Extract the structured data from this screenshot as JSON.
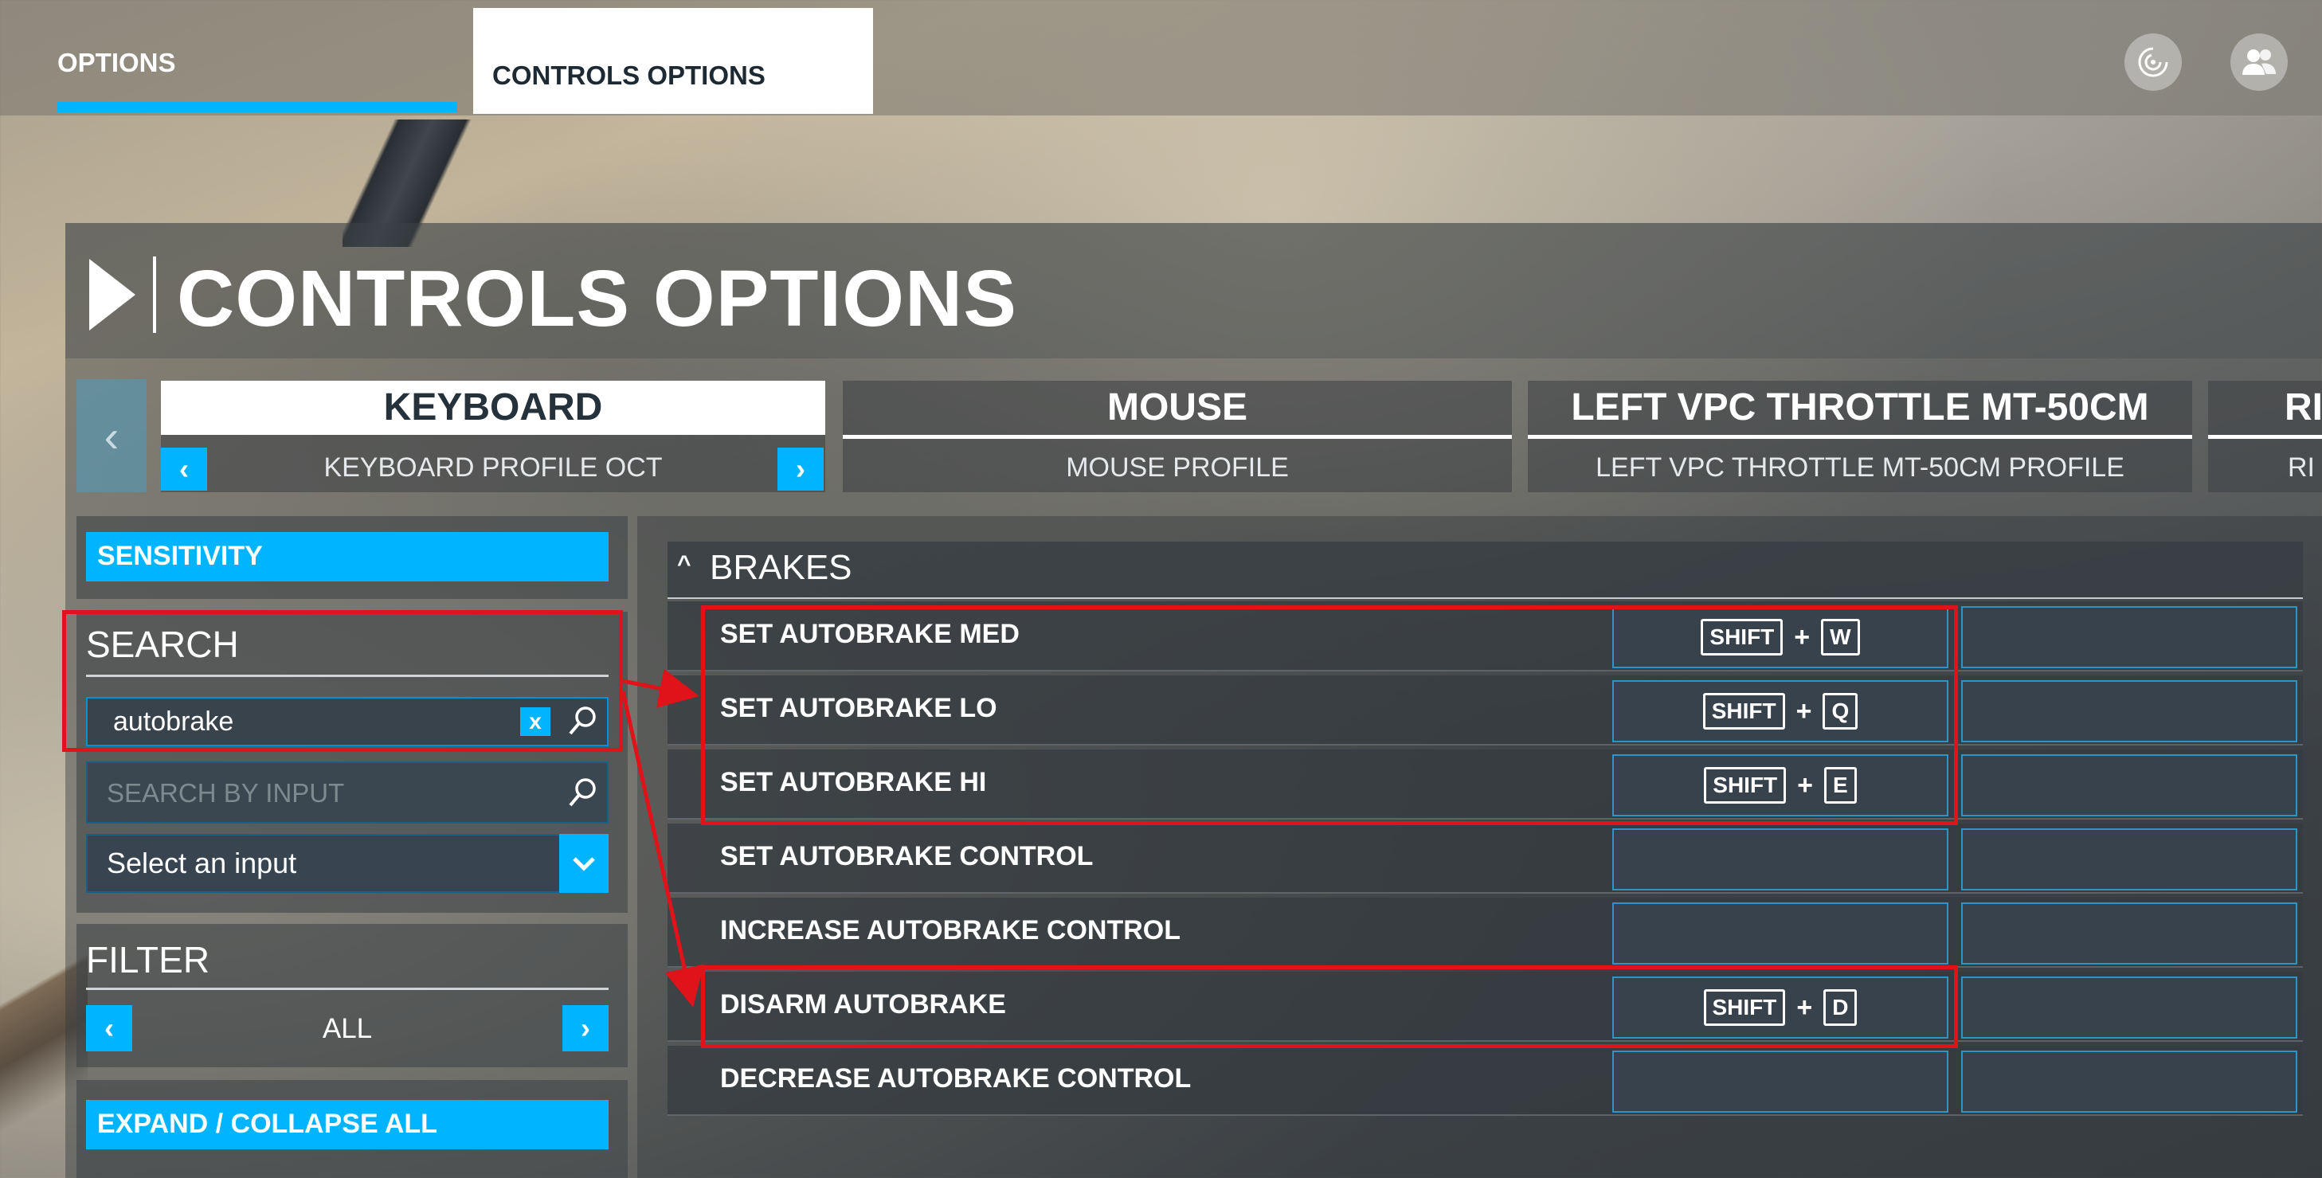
{
  "top_tabs": {
    "options": "OPTIONS",
    "controls_options": "CONTROLS OPTIONS"
  },
  "icons": {
    "sync": "sync-icon",
    "profile": "profile-icon",
    "search": "search-icon",
    "clear": "clear-icon",
    "dropdown": "chevron-down-icon"
  },
  "page_title": "CONTROLS OPTIONS",
  "devices": [
    {
      "name": "KEYBOARD",
      "profile": "KEYBOARD PROFILE OCT"
    },
    {
      "name": "MOUSE",
      "profile": "MOUSE PROFILE"
    },
    {
      "name": "LEFT VPC THROTTLE MT-50CM",
      "profile": "LEFT VPC THROTTLE MT-50CM PROFILE"
    },
    {
      "name": "RI",
      "profile": "RI"
    }
  ],
  "sidebar": {
    "sensitivity": "SENSITIVITY",
    "search_title": "SEARCH",
    "search_value": "autobrake",
    "clear_label": "x",
    "search_by_input_placeholder": "SEARCH BY INPUT",
    "select_input": "Select an input",
    "filter_title": "FILTER",
    "filter_value": "ALL",
    "expand_collapse": "EXPAND / COLLAPSE ALL"
  },
  "section": {
    "title": "BRAKES",
    "caret": "^"
  },
  "bindings": [
    {
      "label": "SET AUTOBRAKE MED",
      "modifier": "SHIFT",
      "plus": "+",
      "key": "W"
    },
    {
      "label": "SET AUTOBRAKE LO",
      "modifier": "SHIFT",
      "plus": "+",
      "key": "Q"
    },
    {
      "label": "SET AUTOBRAKE HI",
      "modifier": "SHIFT",
      "plus": "+",
      "key": "E"
    },
    {
      "label": "SET AUTOBRAKE CONTROL",
      "modifier": "",
      "plus": "",
      "key": ""
    },
    {
      "label": "INCREASE AUTOBRAKE CONTROL",
      "modifier": "",
      "plus": "",
      "key": ""
    },
    {
      "label": "DISARM AUTOBRAKE",
      "modifier": "SHIFT",
      "plus": "+",
      "key": "D"
    },
    {
      "label": "DECREASE AUTOBRAKE CONTROL",
      "modifier": "",
      "plus": "",
      "key": ""
    }
  ],
  "colors": {
    "accent": "#00b4ff",
    "annotation": "#e0121a",
    "panel_text": "#ffffff"
  }
}
